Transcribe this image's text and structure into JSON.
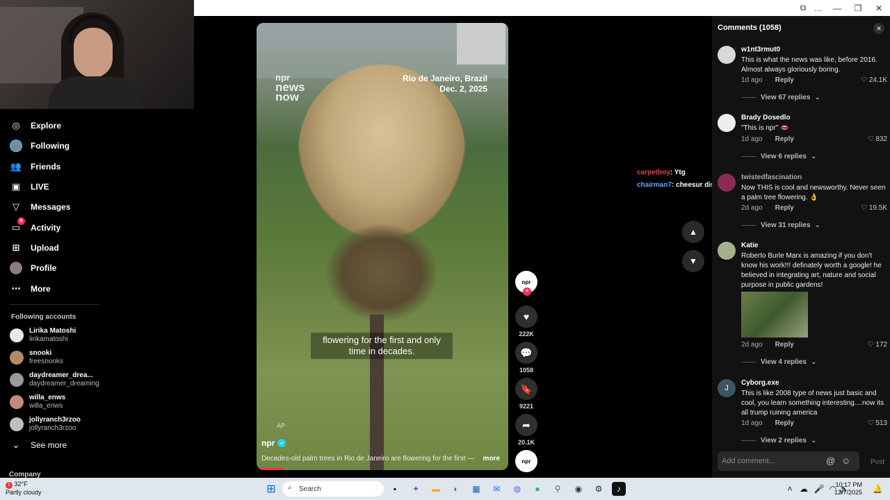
{
  "window": {
    "controls": [
      "⧉",
      "…",
      "—",
      "❐",
      "✕"
    ]
  },
  "sidebar": {
    "nav": [
      {
        "label": "Explore",
        "icon": "compass-icon",
        "glyph": "◎"
      },
      {
        "label": "Following",
        "icon": "avatar",
        "glyph": ""
      },
      {
        "label": "Friends",
        "icon": "friends-icon",
        "glyph": "👥"
      },
      {
        "label": "LIVE",
        "icon": "live-icon",
        "glyph": "▣"
      },
      {
        "label": "Messages",
        "icon": "messages-icon",
        "glyph": "▽"
      },
      {
        "label": "Activity",
        "icon": "activity-icon",
        "glyph": "▭"
      },
      {
        "label": "Upload",
        "icon": "upload-icon",
        "glyph": "⊞"
      },
      {
        "label": "Profile",
        "icon": "profile-icon",
        "glyph": ""
      },
      {
        "label": "More",
        "icon": "more-icon",
        "glyph": "⋯"
      }
    ],
    "activity_badge": "9",
    "following_label": "Following accounts",
    "accounts": [
      {
        "name": "Lirika Matoshi",
        "handle": "lirikamatoshi"
      },
      {
        "name": "snooki",
        "handle": "freesnooks"
      },
      {
        "name": "daydreamer_drea...",
        "handle": "daydreamer_dreaming"
      },
      {
        "name": "willa_enws",
        "handle": "willa_enws"
      },
      {
        "name": "jollyranch3rzoo",
        "handle": "jollyranch3rzoo"
      }
    ],
    "see_more": "See more",
    "company": "Company"
  },
  "video": {
    "watermark": [
      "npr",
      "news",
      "now"
    ],
    "location": "Rio de Janeiro, Brazil",
    "date": "Dec. 2, 2025",
    "caption": "flowering for the first and only time in decades.",
    "credit": "AP",
    "author": "npr",
    "description": "Decades-old palm trees in Rio de Janeiro are flowering for the first —",
    "more": "more",
    "progress": 0.11
  },
  "actions": {
    "profile_badge": "npr",
    "likes": "222K",
    "comments": "1058",
    "saves": "9221",
    "shares": "20.1K"
  },
  "chat": [
    {
      "user": "carpetboy",
      "msg": ": Ytg"
    },
    {
      "user": "chairman7",
      "msg": ": cheesur diss"
    }
  ],
  "comments": {
    "header": "Comments (1058)",
    "items": [
      {
        "user": "w1nt3rmut0",
        "text": "This is what the news was like, before 2016. Almost always gloriously boring.",
        "time": "1d ago",
        "reply": "Reply",
        "likes": "24.1K",
        "replies": "View 67 replies"
      },
      {
        "user": "Brady Dosedlo",
        "text": "\"This is npr\" 👄",
        "time": "1d ago",
        "reply": "Reply",
        "likes": "832",
        "replies": "View 6 replies"
      },
      {
        "user": "twistedfascination",
        "text": "Now THIS is cool and newsworthy. Never seen a palm tree flowering. 👌",
        "time": "2d ago",
        "reply": "Reply",
        "likes": "19.5K",
        "replies": "View 31 replies"
      },
      {
        "user": "Katie",
        "text": "Roberto Burle Marx is amazing if you don't know his work!!! definately worth a google! he believed in integrating art, nature and social purpose in public gardens!",
        "time": "2d ago",
        "reply": "Reply",
        "likes": "172",
        "replies": "View 4 replies"
      },
      {
        "user": "Cyborg.exe",
        "text": "This is like 2008 type of news just basic and cool, you learn something interesting....now its all trump ruining america",
        "time": "1d ago",
        "reply": "Reply",
        "likes": "513",
        "replies": "View 2 replies",
        "initial": "J"
      }
    ],
    "add_placeholder": "Add comment...",
    "post": "Post"
  },
  "taskbar": {
    "weather_temp": "32°F",
    "weather_desc": "Partly cloudy",
    "weather_badge": "1",
    "search": "Search",
    "time": "10:17 PM",
    "date": "12/7/2025"
  }
}
